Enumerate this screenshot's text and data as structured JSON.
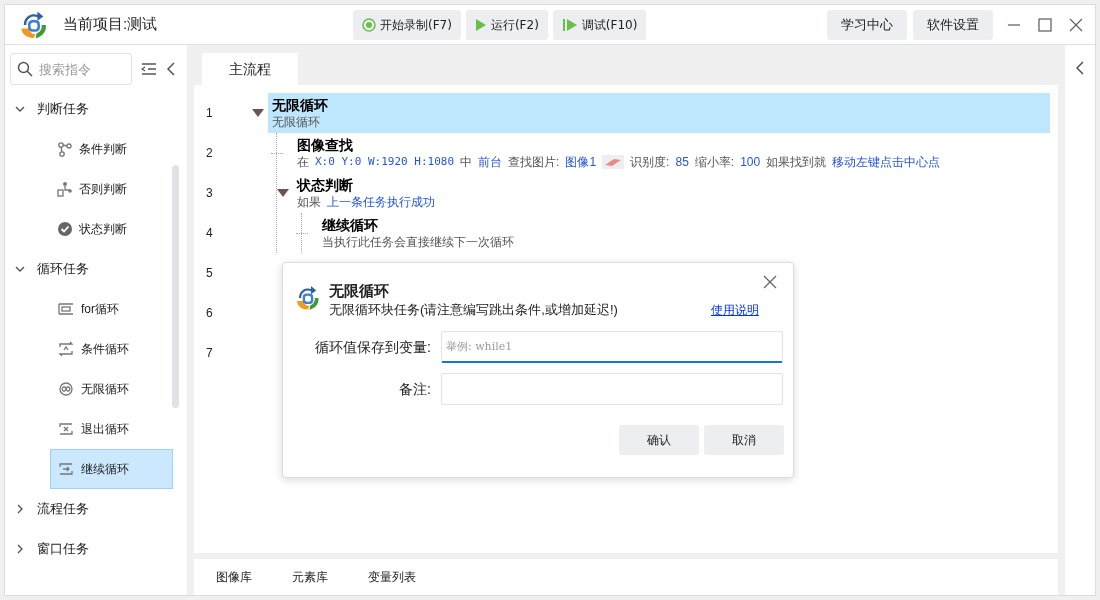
{
  "title_bar": {
    "project": "当前项目:测试",
    "toolbar": [
      {
        "label": "开始录制(F7)",
        "kind": "record"
      },
      {
        "label": "运行(F2)",
        "kind": "run"
      },
      {
        "label": "调试(F10)",
        "kind": "debug"
      }
    ],
    "right_buttons": [
      "学习中心",
      "软件设置"
    ]
  },
  "sidebar": {
    "search": {
      "placeholder": "搜索指令"
    },
    "groups": [
      {
        "label": "判断任务",
        "expanded": true,
        "items": [
          {
            "label": "条件判断",
            "kind": "branch",
            "selected": false
          },
          {
            "label": "否则判断",
            "kind": "else",
            "selected": false
          },
          {
            "label": "状态判断",
            "kind": "check",
            "selected": false
          }
        ]
      },
      {
        "label": "循环任务",
        "expanded": true,
        "items": [
          {
            "label": "for循环",
            "kind": "for",
            "selected": false
          },
          {
            "label": "条件循环",
            "kind": "while",
            "selected": false
          },
          {
            "label": "无限循环",
            "kind": "infinite",
            "selected": false
          },
          {
            "label": "退出循环",
            "kind": "exit",
            "selected": false
          },
          {
            "label": "继续循环",
            "kind": "continue",
            "selected": true
          }
        ]
      },
      {
        "label": "流程任务",
        "expanded": false
      },
      {
        "label": "窗口任务",
        "expanded": false
      }
    ]
  },
  "editor": {
    "tabs": [
      {
        "label": "主流程",
        "selected": true
      }
    ],
    "line_numbers": [
      "1",
      "2",
      "3",
      "4",
      "5",
      "6",
      "7"
    ],
    "rows": [
      {
        "title": "无限循环",
        "selected": true,
        "expanded": true,
        "description": [
          {
            "kind": "plain",
            "text": "无限循环"
          }
        ],
        "children": [
          {
            "title": "图像查找",
            "selected": false,
            "description": [
              {
                "kind": "plain",
                "text": "在"
              },
              {
                "kind": "code",
                "text": "X:0 Y:0 W:1920 H:1080"
              },
              {
                "kind": "plain",
                "text": "中"
              },
              {
                "kind": "link",
                "text": "前台"
              },
              {
                "kind": "plain",
                "text": "查找图片:"
              },
              {
                "kind": "link",
                "text": "图像1"
              },
              {
                "kind": "thumbnail"
              },
              {
                "kind": "plain",
                "text": "识别度:"
              },
              {
                "kind": "link",
                "text": "85"
              },
              {
                "kind": "plain",
                "text": "缩小率:"
              },
              {
                "kind": "link",
                "text": "100"
              },
              {
                "kind": "plain",
                "text": "如果找到就"
              },
              {
                "kind": "link",
                "text": "移动左键点击中心点"
              }
            ]
          },
          {
            "title": "状态判断",
            "selected": false,
            "expanded": true,
            "description": [
              {
                "kind": "plain",
                "text": "如果"
              },
              {
                "kind": "link",
                "text": "上一条任务执行成功"
              }
            ],
            "children": [
              {
                "title": "继续循环",
                "selected": false,
                "description": [
                  {
                    "kind": "plain",
                    "text": "当执行此任务会直接继续下一次循环"
                  }
                ]
              }
            ]
          }
        ]
      }
    ]
  },
  "bottom_tabs": [
    {
      "label": "图像库",
      "selected": false
    },
    {
      "label": "元素库",
      "selected": false
    },
    {
      "label": "变量列表",
      "selected": false
    }
  ],
  "dialog": {
    "title": "无限循环",
    "subtitle": "无限循环块任务(请注意编写跳出条件,或增加延迟!)",
    "help_link": "使用说明",
    "fields": [
      {
        "label": "循环值保存到变量:",
        "placeholder": "举例: while1",
        "focused": true
      },
      {
        "label": "备注:",
        "focused": false
      }
    ],
    "buttons": [
      "确认",
      "取消"
    ]
  }
}
